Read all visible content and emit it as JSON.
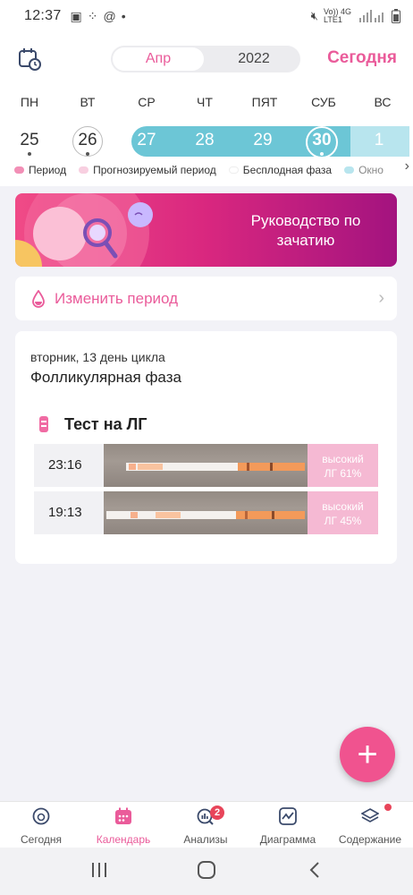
{
  "status": {
    "time": "12:37",
    "network": "Vo)) 4G LTE1"
  },
  "header": {
    "month": "Апр",
    "year": "2022",
    "today": "Сегодня"
  },
  "week": {
    "days_of_week": [
      "ПН",
      "ВТ",
      "СР",
      "ЧТ",
      "ПЯТ",
      "СУБ",
      "ВС"
    ],
    "dates": [
      "25",
      "26",
      "27",
      "28",
      "29",
      "30",
      "1"
    ]
  },
  "legend": {
    "items": [
      {
        "label": "Период",
        "color": "#f28fb6"
      },
      {
        "label": "Прогнозируемый период",
        "color": "#f8cfe0"
      },
      {
        "label": "Бесплодная фаза",
        "color": "#ffffff"
      },
      {
        "label": "Окно",
        "color": "#b8e5ee"
      }
    ]
  },
  "banner": {
    "text": "Руководство по зачатию"
  },
  "period_card": {
    "label": "Изменить период"
  },
  "cycle": {
    "subtitle": "вторник, 13 день цикла",
    "phase": "Фолликулярная фаза",
    "lh_title": "Тест на ЛГ",
    "tests": [
      {
        "time": "23:16",
        "result_line1": "высокий",
        "result_line2": "ЛГ 61%"
      },
      {
        "time": "19:13",
        "result_line1": "высокий",
        "result_line2": "ЛГ 45%"
      }
    ]
  },
  "fab": {
    "label": "+"
  },
  "tabs": [
    {
      "label": "Сегодня",
      "icon": "today-icon"
    },
    {
      "label": "Календарь",
      "icon": "calendar-icon"
    },
    {
      "label": "Анализы",
      "icon": "analysis-icon",
      "badge": "2"
    },
    {
      "label": "Диаграмма",
      "icon": "chart-icon"
    },
    {
      "label": "Содержание",
      "icon": "content-icon"
    }
  ],
  "colors": {
    "accent": "#ea5b9a",
    "fertile": "#6cc6d6",
    "fab": "#f0538f"
  }
}
